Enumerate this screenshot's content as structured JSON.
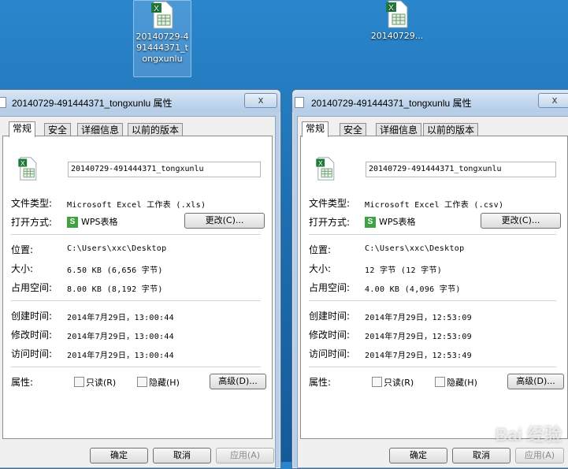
{
  "desktop": {
    "icons": [
      {
        "label": "20140729-491444371_tongxunlu"
      },
      {
        "label": "20140729..."
      }
    ]
  },
  "windows": [
    {
      "title": "20140729-491444371_tongxunlu 属性",
      "close": "x",
      "tabs": [
        "常规",
        "安全",
        "详细信息",
        "以前的版本"
      ],
      "filename": "20140729-491444371_tongxunlu",
      "file_type_label": "文件类型:",
      "file_type": "Microsoft Excel 工作表 (.xls)",
      "open_with_label": "打开方式:",
      "open_with": "WPS表格",
      "wps_glyph": "S",
      "change_button": "更改(C)...",
      "location_label": "位置:",
      "location": "C:\\Users\\xxc\\Desktop",
      "size_label": "大小:",
      "size": "6.50 KB (6,656 字节)",
      "disk_label": "占用空间:",
      "disk": "8.00 KB (8,192 字节)",
      "created_label": "创建时间:",
      "created": "2014年7月29日，13:00:44",
      "modified_label": "修改时间:",
      "modified": "2014年7月29日，13:00:44",
      "accessed_label": "访问时间:",
      "accessed": "2014年7月29日，13:00:44",
      "attr_label": "属性:",
      "readonly": "只读(R)",
      "hidden": "隐藏(H)",
      "advanced_button": "高级(D)...",
      "ok": "确定",
      "cancel": "取消",
      "apply": "应用(A)"
    },
    {
      "title": "20140729-491444371_tongxunlu 属性",
      "close": "x",
      "tabs": [
        "常规",
        "安全",
        "详细信息",
        "以前的版本"
      ],
      "filename": "20140729-491444371_tongxunlu",
      "file_type_label": "文件类型:",
      "file_type": "Microsoft Excel 工作表 (.csv)",
      "open_with_label": "打开方式:",
      "open_with": "WPS表格",
      "wps_glyph": "S",
      "change_button": "更改(C)...",
      "location_label": "位置:",
      "location": "C:\\Users\\xxc\\Desktop",
      "size_label": "大小:",
      "size": "12 字节 (12 字节)",
      "disk_label": "占用空间:",
      "disk": "4.00 KB (4,096 字节)",
      "created_label": "创建时间:",
      "created": "2014年7月29日，12:53:09",
      "modified_label": "修改时间:",
      "modified": "2014年7月29日，12:53:09",
      "accessed_label": "访问时间:",
      "accessed": "2014年7月29日，12:53:49",
      "attr_label": "属性:",
      "readonly": "只读(R)",
      "hidden": "隐藏(H)",
      "advanced_button": "高级(D)...",
      "ok": "确定",
      "cancel": "取消",
      "apply": "应用(A)"
    }
  ],
  "watermark": "Bai 经验"
}
